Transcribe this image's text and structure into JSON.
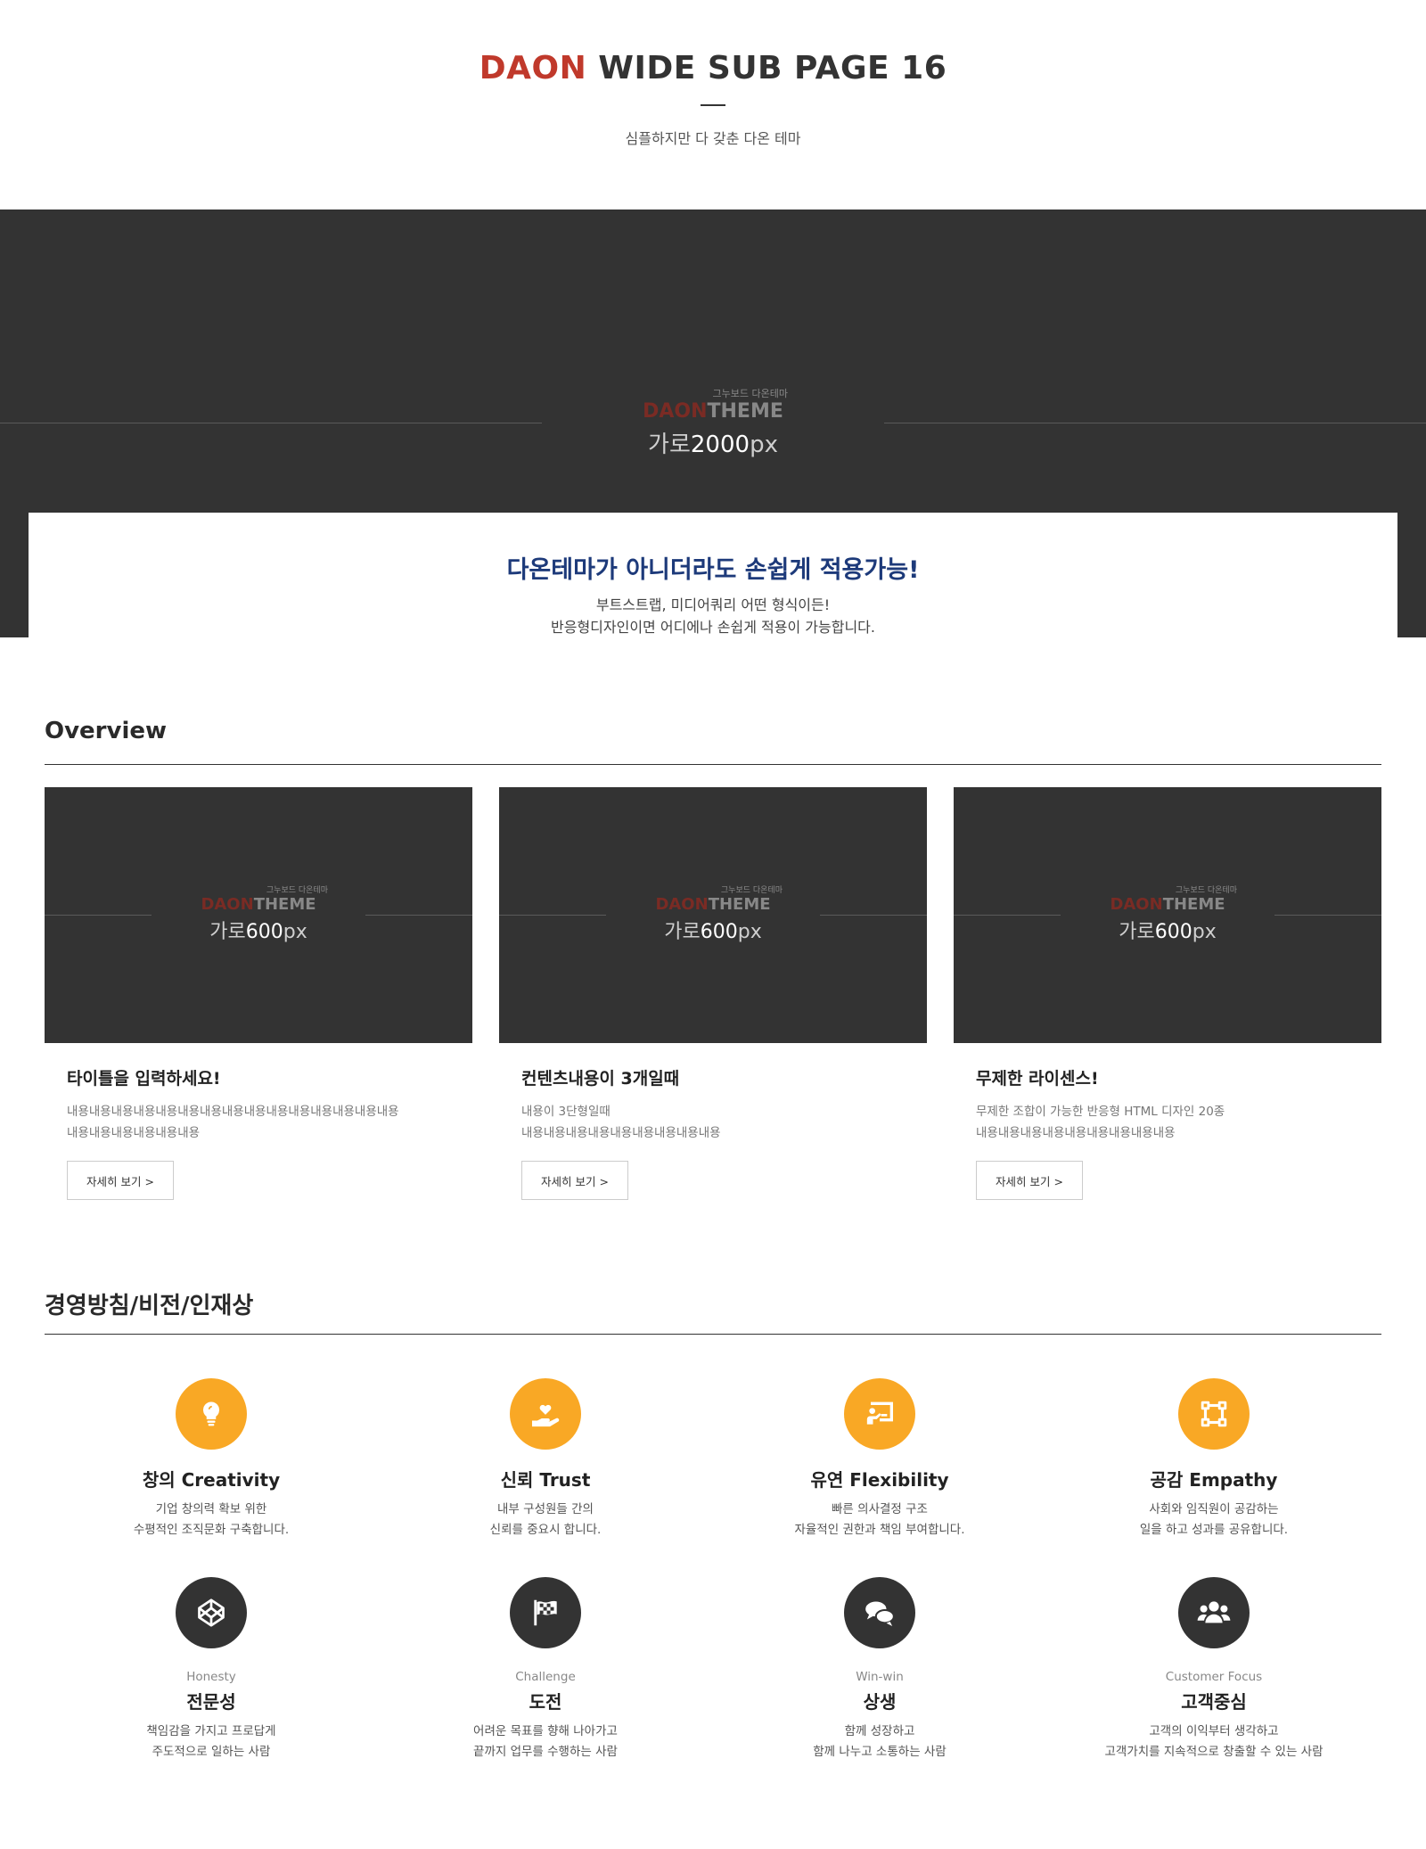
{
  "header": {
    "title_accent": "DAON",
    "title_rest": "WIDE SUB PAGE 16",
    "subtitle": "심플하지만 다 갖춘 다온 테마"
  },
  "hero": {
    "placeholder": {
      "small": "그누보드 다온테마",
      "daon": "DAON",
      "theme": "THEME",
      "size_prefix": "가로",
      "size_value": "2000",
      "size_unit": "px"
    },
    "card": {
      "title": "다온테마가 아니더라도 손쉽게 적용가능!",
      "line1": "부트스트랩, 미디어쿼리 어떤 형식이든!",
      "line2": "반응형디자인이면 어디에나 손쉽게 적용이 가능합니다."
    }
  },
  "overview": {
    "heading": "Overview",
    "cards": [
      {
        "ph_small": "그누보드 다온테마",
        "ph_daon": "DAON",
        "ph_theme": "THEME",
        "ph_prefix": "가로",
        "ph_value": "600",
        "ph_unit": "px",
        "title": "타이틀을 입력하세요!",
        "line1": "내용내용내용내용내용내용내용내용내용내용내용내용내용내용내용",
        "line2": "내용내용내용내용내용내용",
        "button": "자세히 보기 >"
      },
      {
        "ph_small": "그누보드 다온테마",
        "ph_daon": "DAON",
        "ph_theme": "THEME",
        "ph_prefix": "가로",
        "ph_value": "600",
        "ph_unit": "px",
        "title": "컨텐츠내용이 3개일때",
        "line1": "내용이 3단형일때",
        "line2": "내용내용내용내용내용내용내용내용내용",
        "button": "자세히 보기 >"
      },
      {
        "ph_small": "그누보드 다온테마",
        "ph_daon": "DAON",
        "ph_theme": "THEME",
        "ph_prefix": "가로",
        "ph_value": "600",
        "ph_unit": "px",
        "title": "무제한 라이센스!",
        "line1": "무제한 조합이 가능한 반응형 HTML 디자인 20종",
        "line2": "내용내용내용내용내용내용내용내용내용",
        "button": "자세히 보기 >"
      }
    ]
  },
  "values": {
    "heading": "경영방침/비전/인재상",
    "row1": [
      {
        "icon": "lightbulb-icon",
        "title": "창의 Creativity",
        "line1": "기업 창의력 확보 위한",
        "line2": "수평적인 조직문화 구축합니다."
      },
      {
        "icon": "heart-hand-icon",
        "title": "신뢰 Trust",
        "line1": "내부 구성원들 간의",
        "line2": "신뢰를 중요시 합니다."
      },
      {
        "icon": "presentation-icon",
        "title": "유연 Flexibility",
        "line1": "빠른 의사결정 구조",
        "line2": "자율적인 권한과 책임 부여합니다."
      },
      {
        "icon": "vector-square-icon",
        "title": "공감 Empathy",
        "line1": "사회와 임직원이 공감하는",
        "line2": "일을 하고 성과를 공유합니다."
      }
    ],
    "row2": [
      {
        "icon": "codepen-icon",
        "en": "Honesty",
        "title": "전문성",
        "line1": "책임감을 가지고 프로답게",
        "line2": "주도적으로 일하는 사람"
      },
      {
        "icon": "checkered-flag-icon",
        "en": "Challenge",
        "title": "도전",
        "line1": "어려운 목표를 향해 나아가고",
        "line2": "끝까지 업무를 수행하는 사람"
      },
      {
        "icon": "chat-bubbles-icon",
        "en": "Win-win",
        "title": "상생",
        "line1": "함께 성장하고",
        "line2": "함께 나누고 소통하는 사람"
      },
      {
        "icon": "users-icon",
        "en": "Customer Focus",
        "title": "고객중심",
        "line1": "고객의 이익부터 생각하고",
        "line2": "고객가치를 지속적으로 창출할 수 있는 사람"
      }
    ],
    "colors": {
      "orange": "#f9a825",
      "dark": "#333333"
    }
  }
}
